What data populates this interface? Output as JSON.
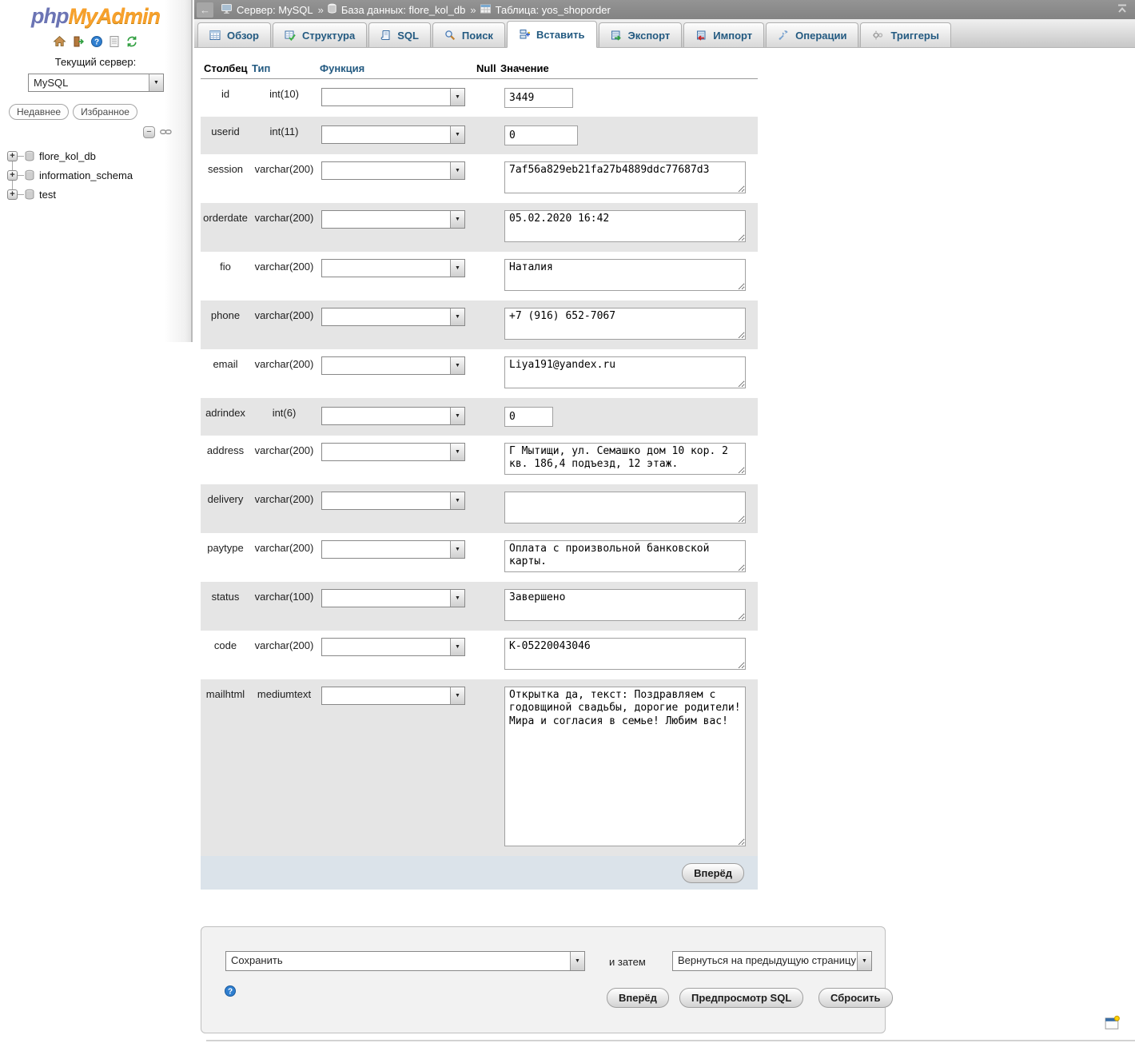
{
  "icons": {
    "plus": "+",
    "minus": "−",
    "dropdown_arrow": "▼",
    "back_arrow": "←"
  },
  "logo": {
    "php": "php",
    "myadmin": "MyAdmin"
  },
  "sidebar": {
    "server_label": "Текущий сервер:",
    "server_select_value": "MySQL",
    "recent_tab": "Недавнее",
    "favorites_tab": "Избранное",
    "tree": [
      {
        "label": "flore_kol_db"
      },
      {
        "label": "information_schema"
      },
      {
        "label": "test"
      }
    ]
  },
  "breadcrumb": {
    "separator": "»",
    "items": [
      {
        "label": "Сервер: MySQL"
      },
      {
        "label": "База данных: flore_kol_db"
      },
      {
        "label": "Таблица: yos_shoporder"
      }
    ]
  },
  "tabs": [
    {
      "label": "Обзор",
      "active": false
    },
    {
      "label": "Структура",
      "active": false
    },
    {
      "label": "SQL",
      "active": false
    },
    {
      "label": "Поиск",
      "active": false
    },
    {
      "label": "Вставить",
      "active": true
    },
    {
      "label": "Экспорт",
      "active": false
    },
    {
      "label": "Импорт",
      "active": false
    },
    {
      "label": "Операции",
      "active": false
    },
    {
      "label": "Триггеры",
      "active": false
    }
  ],
  "insert_form": {
    "headers": {
      "column": "Столбец",
      "type": "Тип",
      "function": "Функция",
      "null": "Null",
      "value": "Значение"
    },
    "rows": [
      {
        "column": "id",
        "type": "int(10)",
        "value": "3449"
      },
      {
        "column": "userid",
        "type": "int(11)",
        "value": "0"
      },
      {
        "column": "session",
        "type": "varchar(200)",
        "value": "7af56a829eb21fa27b4889ddc77687d3"
      },
      {
        "column": "orderdate",
        "type": "varchar(200)",
        "value": "05.02.2020 16:42"
      },
      {
        "column": "fio",
        "type": "varchar(200)",
        "value": "Наталия"
      },
      {
        "column": "phone",
        "type": "varchar(200)",
        "value": "+7 (916) 652-7067"
      },
      {
        "column": "email",
        "type": "varchar(200)",
        "value": "Liya191@yandex.ru"
      },
      {
        "column": "adrindex",
        "type": "int(6)",
        "value": "0"
      },
      {
        "column": "address",
        "type": "varchar(200)",
        "value": "Г Мытищи, ул. Семашко дом 10 кор. 2 кв. 186,4 подъезд, 12 этаж."
      },
      {
        "column": "delivery",
        "type": "varchar(200)",
        "value": ""
      },
      {
        "column": "paytype",
        "type": "varchar(200)",
        "value": "Оплата с произвольной банковской карты."
      },
      {
        "column": "status",
        "type": "varchar(100)",
        "value": "Завершено"
      },
      {
        "column": "code",
        "type": "varchar(200)",
        "value": "К-05220043046"
      },
      {
        "column": "mailhtml",
        "type": "mediumtext",
        "value": "Открытка да, текст: Поздравляем с годовщиной свадьбы, дорогие родители! Мира и согласия в семье! Любим вас!"
      }
    ],
    "go_button": "Вперёд"
  },
  "actions_panel": {
    "save_select_value": "Сохранить",
    "and_then_label": "и затем",
    "return_select_value": "Вернуться на предыдущую страницу",
    "go_button": "Вперёд",
    "preview_button": "Предпросмотр SQL",
    "reset_button": "Сбросить"
  },
  "colors": {
    "accent_blue": "#235a81",
    "logo_orange": "#f8a12c",
    "logo_slate": "#6b74b4",
    "row_alt": "#e5e5e5",
    "footer_bar": "#dbe3ea",
    "crumb_gray": "#8c8c8c"
  }
}
